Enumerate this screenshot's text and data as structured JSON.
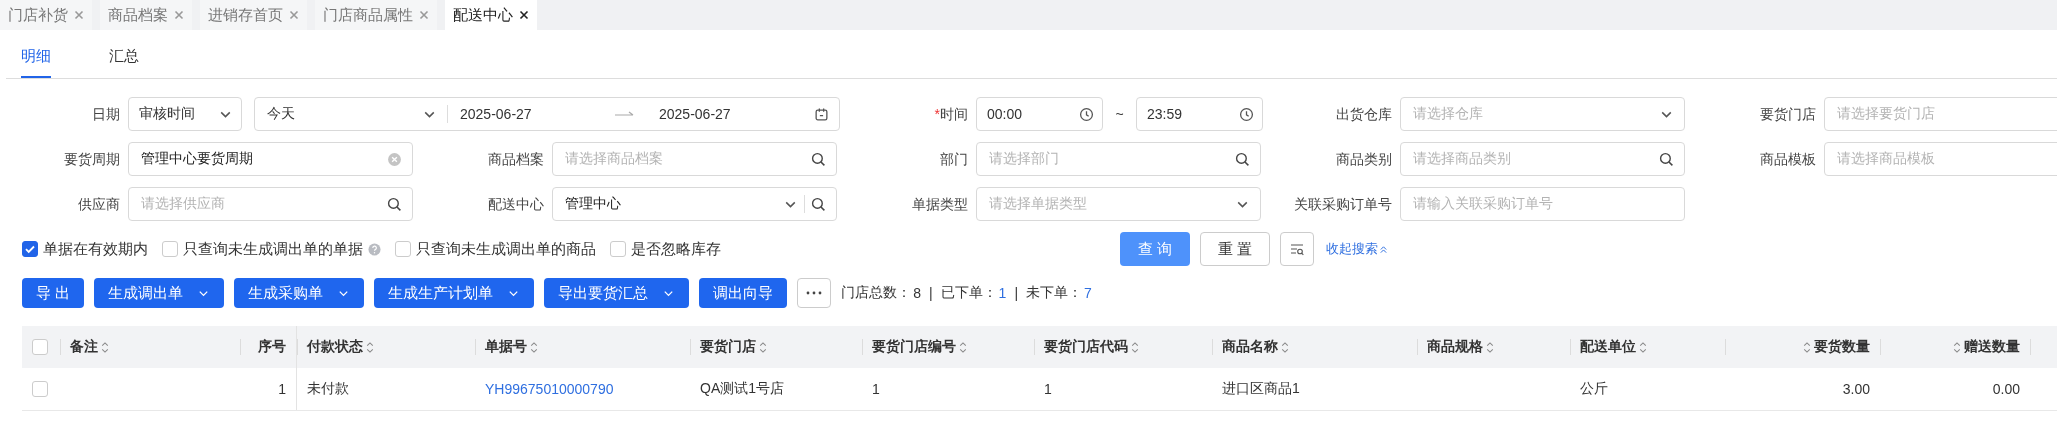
{
  "tabs": [
    {
      "label": "门店补货",
      "selected": false
    },
    {
      "label": "商品档案",
      "selected": false
    },
    {
      "label": "进销存首页",
      "selected": false
    },
    {
      "label": "门店商品属性",
      "selected": false
    },
    {
      "label": "配送中心",
      "selected": true
    }
  ],
  "view_tabs": [
    {
      "label": "明细",
      "selected": true
    },
    {
      "label": "汇总",
      "selected": false
    }
  ],
  "filters": [
    {
      "kind": "date",
      "label": "日期",
      "type_select": "审核时间",
      "range_select": "今天",
      "start": "2025-06-27",
      "end": "2025-06-27"
    },
    {
      "kind": "time",
      "label": "时间",
      "required_mark": "*",
      "start": "00:00",
      "separator": "~",
      "end": "23:59"
    },
    {
      "kind": "select",
      "label": "出货仓库",
      "placeholder": "请选择仓库"
    },
    {
      "kind": "text",
      "label": "要货门店",
      "placeholder": "请选择要货门店"
    },
    {
      "kind": "clear",
      "label": "要货周期",
      "value": "管理中心要货周期"
    },
    {
      "kind": "search",
      "label": "商品档案",
      "placeholder": "请选择商品档案"
    },
    {
      "kind": "search",
      "label": "部门",
      "placeholder": "请选择部门"
    },
    {
      "kind": "search",
      "label": "商品类别",
      "placeholder": "请选择商品类别"
    },
    {
      "kind": "text",
      "label": "商品模板",
      "placeholder": "请选择商品模板"
    },
    {
      "kind": "search",
      "label": "供应商",
      "placeholder": "请选择供应商"
    },
    {
      "kind": "select_search",
      "label": "配送中心",
      "value": "管理中心"
    },
    {
      "kind": "select",
      "label": "单据类型",
      "placeholder": "请选择单据类型"
    },
    {
      "kind": "text",
      "label": "关联采购订单号",
      "placeholder": "请输入关联采购订单号"
    }
  ],
  "options": [
    {
      "label": "单据在有效期内",
      "checked": true,
      "help": false
    },
    {
      "label": "只查询未生成调出单的单据",
      "checked": false,
      "help": true
    },
    {
      "label": "只查询未生成调出单的商品",
      "checked": false,
      "help": false
    },
    {
      "label": "是否忽略库存",
      "checked": false,
      "help": false
    }
  ],
  "search_actions": {
    "query": "查 询",
    "reset": "重 置",
    "collapse": "收起搜索"
  },
  "toolbar": [
    {
      "label": "导 出",
      "dropdown": false
    },
    {
      "label": "生成调出单",
      "dropdown": true
    },
    {
      "label": "生成采购单",
      "dropdown": true
    },
    {
      "label": "生成生产计划单",
      "dropdown": true
    },
    {
      "label": "导出要货汇总",
      "dropdown": true
    },
    {
      "label": "调出向导",
      "dropdown": false
    }
  ],
  "summary": [
    {
      "label": "门店总数：",
      "value": "8"
    },
    {
      "divider": "|",
      "label": "已下单：",
      "value": "1"
    },
    {
      "divider": "|",
      "label": "未下单：",
      "value": "7"
    }
  ],
  "table": {
    "all_checked": false,
    "columns": [
      {
        "label": "备注",
        "sortable": true,
        "kind": "text"
      },
      {
        "label": "序号",
        "sortable": false,
        "kind": "number"
      },
      {
        "label": "付款状态",
        "sortable": true,
        "kind": "text"
      },
      {
        "label": "单据号",
        "sortable": true,
        "kind": "link"
      },
      {
        "label": "要货门店",
        "sortable": true,
        "kind": "text"
      },
      {
        "label": "要货门店编号",
        "sortable": true,
        "kind": "text"
      },
      {
        "label": "要货门店代码",
        "sortable": true,
        "kind": "text"
      },
      {
        "label": "商品名称",
        "sortable": true,
        "kind": "text"
      },
      {
        "label": "商品规格",
        "sortable": true,
        "kind": "text"
      },
      {
        "label": "配送单位",
        "sortable": true,
        "kind": "text"
      },
      {
        "label": "要货数量",
        "sortable": true,
        "kind": "number"
      },
      {
        "label": "赠送数量",
        "sortable": true,
        "kind": "number"
      }
    ],
    "rows": [
      {
        "selected": false,
        "cells": [
          "",
          "1",
          "未付款",
          "YH99675010000790",
          "QA测试1号店",
          "1",
          "1",
          "进口区商品1",
          "",
          "公斤",
          "3.00",
          "0.00"
        ]
      }
    ]
  }
}
